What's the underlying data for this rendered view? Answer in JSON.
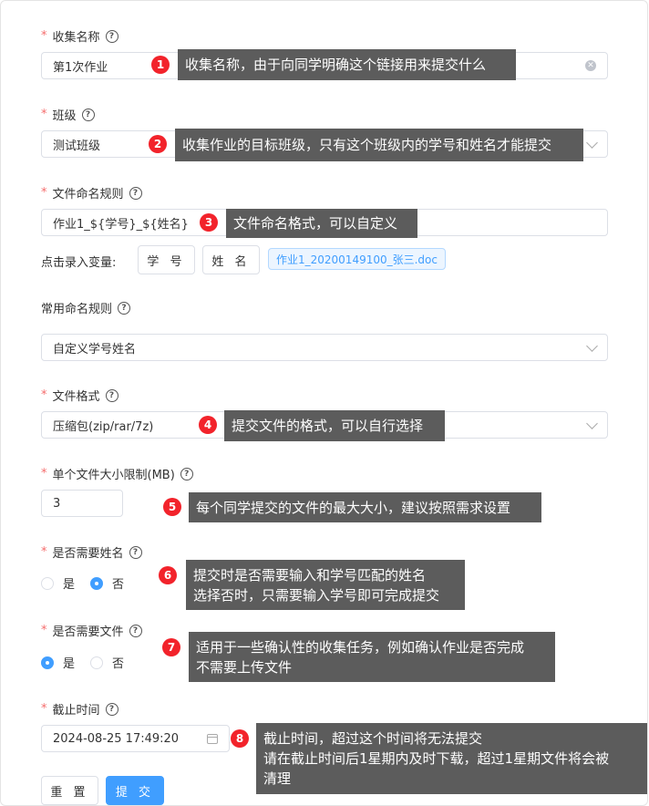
{
  "form": {
    "collection_name": {
      "label": "收集名称",
      "value": "第1次作业"
    },
    "class": {
      "label": "班级",
      "value": "测试班级"
    },
    "file_naming_rule": {
      "label": "文件命名规则",
      "value": "作业1_${学号}_${姓名}",
      "variables_label": "点击录入变量:",
      "var_buttons": [
        "学 号",
        "姓 名"
      ],
      "preview": "作业1_20200149100_张三.doc"
    },
    "common_naming_rule": {
      "label": "常用命名规则",
      "value": "自定义学号姓名"
    },
    "file_format": {
      "label": "文件格式",
      "value": "压缩包(zip/rar/7z)"
    },
    "file_size_limit": {
      "label": "单个文件大小限制(MB)",
      "value": "3"
    },
    "need_name": {
      "label": "是否需要姓名",
      "options": [
        "是",
        "否"
      ],
      "selected": "否"
    },
    "need_file": {
      "label": "是否需要文件",
      "options": [
        "是",
        "否"
      ],
      "selected": "是"
    },
    "deadline": {
      "label": "截止时间",
      "value": "2024-08-25 17:49:20"
    },
    "buttons": {
      "reset": "重 置",
      "submit": "提 交"
    }
  },
  "annotations": [
    {
      "num": "1",
      "lines": [
        "收集名称，由于向同学明确这个链接用来提交什么"
      ]
    },
    {
      "num": "2",
      "lines": [
        "收集作业的目标班级，只有这个班级内的学号和姓名才能提交"
      ]
    },
    {
      "num": "3",
      "lines": [
        "文件命名格式，可以自定义"
      ]
    },
    {
      "num": "4",
      "lines": [
        "提交文件的格式，可以自行选择"
      ]
    },
    {
      "num": "5",
      "lines": [
        "每个同学提交的文件的最大大小，建议按照需求设置"
      ]
    },
    {
      "num": "6",
      "lines": [
        "提交时是否需要输入和学号匹配的姓名",
        "选择否时，只需要输入学号即可完成提交"
      ]
    },
    {
      "num": "7",
      "lines": [
        "适用于一些确认性的收集任务，例如确认作业是否完成",
        "不需要上传文件"
      ]
    },
    {
      "num": "8",
      "lines": [
        "截止时间，超过这个时间将无法提交",
        "请在截止时间后1星期内及时下载，超过1星期文件将会被",
        "清理"
      ]
    }
  ],
  "icons": {
    "help": "question-circle-icon",
    "clear": "clear-circle-icon",
    "dropdown": "chevron-down-icon",
    "calendar": "calendar-icon"
  },
  "colors": {
    "required": "#f56c6c",
    "primary": "#409eff",
    "badge": "#f2232b",
    "tooltip_bg": "#5c5c5c"
  }
}
